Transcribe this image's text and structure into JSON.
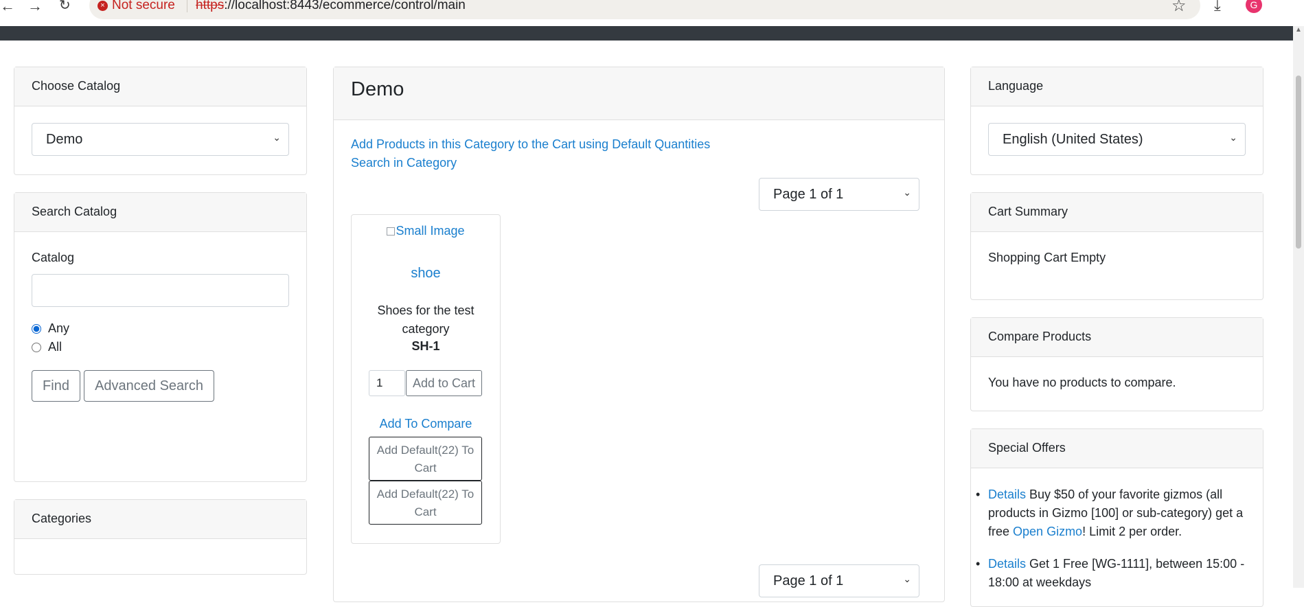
{
  "browser": {
    "security_label": "Not secure",
    "url_scheme": "https",
    "url_rest": "://localhost:8443/ecommerce/control/main",
    "profile_initial": "G"
  },
  "left": {
    "choose_catalog": {
      "title": "Choose Catalog",
      "selected": "Demo"
    },
    "search_catalog": {
      "title": "Search Catalog",
      "field_label": "Catalog",
      "field_value": "",
      "radio_any": "Any",
      "radio_all": "All",
      "selected_radio": "Any",
      "find_label": "Find",
      "advanced_label": "Advanced Search"
    },
    "categories": {
      "title": "Categories"
    }
  },
  "main": {
    "title": "Demo",
    "add_products_link": "Add Products in this Category to the Cart using Default Quantities",
    "search_in_category_link": "Search in Category",
    "pager_label": "Page 1 of 1",
    "product": {
      "image_alt": "Small Image",
      "name": "shoe",
      "description": "Shoes for the test category",
      "sku": "SH-1",
      "quantity": "1",
      "add_to_cart": "Add to Cart",
      "add_to_compare": "Add To Compare",
      "add_default_1": "Add Default(22) To Cart",
      "add_default_2": "Add Default(22) To Cart"
    }
  },
  "right": {
    "language": {
      "title": "Language",
      "selected": "English (United States)"
    },
    "cart_summary": {
      "title": "Cart Summary",
      "text": "Shopping Cart Empty"
    },
    "compare": {
      "title": "Compare Products",
      "text": "You have no products to compare."
    },
    "special_offers": {
      "title": "Special Offers",
      "offers": [
        {
          "link": "Details",
          "text_before": " Buy $50 of your favorite gizmos (all products in Gizmo [100] or sub-category) get a free ",
          "inner_link": "Open Gizmo",
          "text_after": "! Limit 2 per order."
        },
        {
          "link": "Details",
          "text_before": " Get 1 Free [WG-1111], between 15:00 - 18:00 at weekdays",
          "inner_link": "",
          "text_after": ""
        }
      ]
    }
  }
}
